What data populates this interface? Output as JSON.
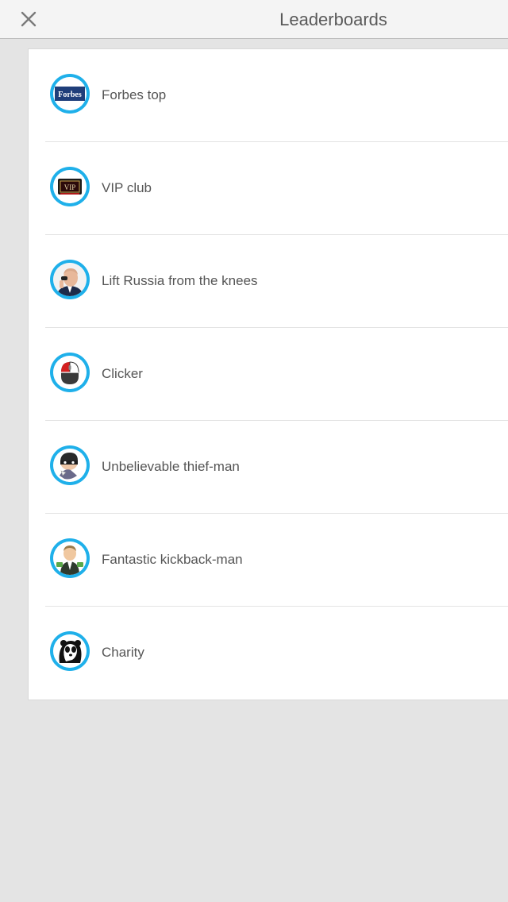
{
  "header": {
    "title": "Leaderboards",
    "close_icon": "close-icon"
  },
  "leaderboards": [
    {
      "label": "Forbes top",
      "icon": "forbes-icon"
    },
    {
      "label": "VIP club",
      "icon": "vip-icon"
    },
    {
      "label": "Lift Russia from the knees",
      "icon": "president-icon"
    },
    {
      "label": "Clicker",
      "icon": "mouse-icon"
    },
    {
      "label": "Unbelievable thief-man",
      "icon": "thief-icon"
    },
    {
      "label": "Fantastic kickback-man",
      "icon": "kickback-man-icon"
    },
    {
      "label": "Charity",
      "icon": "panda-icon"
    }
  ],
  "icon_texts": {
    "forbes": "Forbes",
    "vip": "VIP"
  },
  "colors": {
    "accent_ring": "#1fb0ea",
    "background": "#e4e4e4",
    "text": "#555555"
  }
}
